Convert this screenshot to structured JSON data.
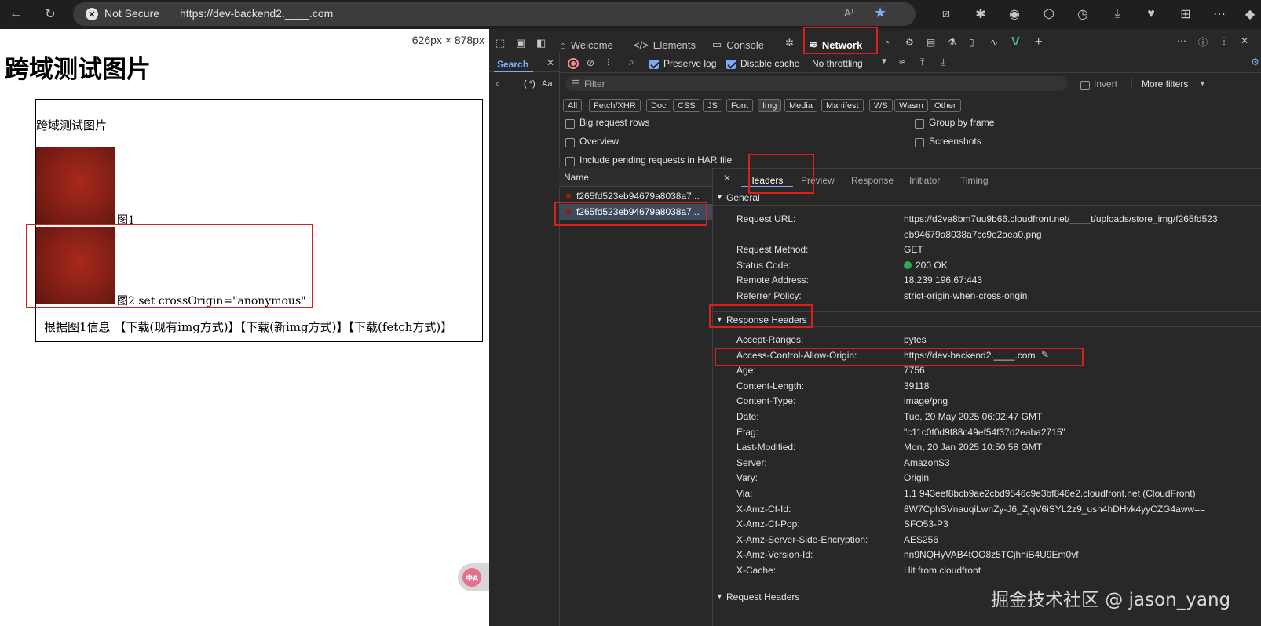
{
  "browser": {
    "security_label": "Not Secure",
    "url": "https://dev-backend2.____.com"
  },
  "page": {
    "viewport_size": "626px × 878px",
    "heading": "跨域测试图片",
    "box_title": "跨域测试图片",
    "img1_caption": "图1",
    "img2_caption": "图2 set crossOrigin=\"anonymous\"",
    "actions_prefix": "根据图1信息",
    "actions": [
      "【下载(现有img方式)】",
      "【下载(新img方式)】",
      "【下载(fetch方式)】"
    ]
  },
  "devtools": {
    "tabs": [
      {
        "label": "Welcome",
        "icon": "home-icon"
      },
      {
        "label": "Elements",
        "icon": "code-icon"
      },
      {
        "label": "Console",
        "icon": "console-icon"
      },
      {
        "label": "Network",
        "icon": "wifi-icon",
        "active": true
      }
    ],
    "search_tab": "Search",
    "regex_label": "(.*)",
    "case_label": "Aa",
    "preserve_log": "Preserve log",
    "disable_cache": "Disable cache",
    "throttling": "No throttling",
    "filter_placeholder": "Filter",
    "invert": "Invert",
    "more_filters": "More filters",
    "type_chips": [
      "All",
      "Fetch/XHR",
      "Doc",
      "CSS",
      "JS",
      "Font",
      "Img",
      "Media",
      "Manifest",
      "WS",
      "Wasm",
      "Other"
    ],
    "selected_chip": "Img",
    "options_left": [
      "Big request rows",
      "Overview",
      "Include pending requests in HAR file"
    ],
    "options_right": [
      "Group by frame",
      "Screenshots"
    ],
    "name_column": "Name",
    "requests": [
      "f265fd523eb94679a8038a7...",
      "f265fd523eb94679a8038a7..."
    ],
    "detail_tabs": [
      "Headers",
      "Preview",
      "Response",
      "Initiator",
      "Timing"
    ],
    "active_detail_tab": "Headers",
    "general": {
      "title": "General",
      "rows": [
        {
          "k": "Request URL:",
          "v": "https://d2ve8bm7uu9b66.cloudfront.net/____t/uploads/store_img/f265fd523"
        },
        {
          "k": "",
          "v": "eb94679a8038a7cc9e2aea0.png"
        },
        {
          "k": "Request Method:",
          "v": "GET"
        },
        {
          "k": "Status Code:",
          "v": "200 OK"
        },
        {
          "k": "Remote Address:",
          "v": "18.239.196.67:443"
        },
        {
          "k": "Referrer Policy:",
          "v": "strict-origin-when-cross-origin"
        }
      ]
    },
    "response_headers": {
      "title": "Response Headers",
      "rows": [
        {
          "k": "Accept-Ranges:",
          "v": "bytes"
        },
        {
          "k": "Access-Control-Allow-Origin:",
          "v": "https://dev-backend2.____.com"
        },
        {
          "k": "Age:",
          "v": "7756"
        },
        {
          "k": "Content-Length:",
          "v": "39118"
        },
        {
          "k": "Content-Type:",
          "v": "image/png"
        },
        {
          "k": "Date:",
          "v": "Tue, 20 May 2025 06:02:47 GMT"
        },
        {
          "k": "Etag:",
          "v": "\"c11c0f0d9f88c49ef54f37d2eaba2715\""
        },
        {
          "k": "Last-Modified:",
          "v": "Mon, 20 Jan 2025 10:50:58 GMT"
        },
        {
          "k": "Server:",
          "v": "AmazonS3"
        },
        {
          "k": "Vary:",
          "v": "Origin"
        },
        {
          "k": "Via:",
          "v": "1.1 943eef8bcb9ae2cbd9546c9e3bf846e2.cloudfront.net (CloudFront)"
        },
        {
          "k": "X-Amz-Cf-Id:",
          "v": "8W7CphSVnauqiLwnZy-J6_ZjqV6iSYL2z9_ush4hDHvk4yyCZG4aww=="
        },
        {
          "k": "X-Amz-Cf-Pop:",
          "v": "SFO53-P3"
        },
        {
          "k": "X-Amz-Server-Side-Encryption:",
          "v": "AES256"
        },
        {
          "k": "X-Amz-Version-Id:",
          "v": "nn9NQHyVAB4tOO8z5TCjhhiB4U9Em0vf"
        },
        {
          "k": "X-Cache:",
          "v": "Hit from cloudfront"
        }
      ]
    },
    "request_headers_title": "Request Headers"
  },
  "watermark": "掘金技术社区 @ jason_yang",
  "translate_badge": "中A"
}
